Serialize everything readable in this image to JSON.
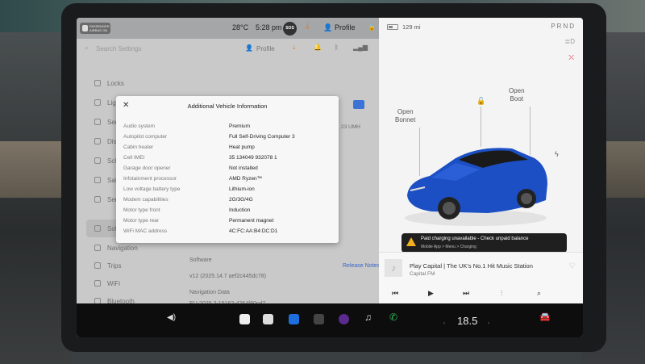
{
  "status_bar": {
    "airbag_label": "PASSENGER AIRBAG ON",
    "temperature": "28°C",
    "time": "5:28 pm",
    "sentry_label": "SOS",
    "profile": "Profile"
  },
  "settings": {
    "search_placeholder": "Search Settings",
    "profile": "Profile",
    "menu": [
      {
        "label": "Locks",
        "icon": "lock-icon"
      },
      {
        "label": "Lights",
        "icon": "lightbulb-icon"
      },
      {
        "label": "Service",
        "icon": "wrench-icon"
      },
      {
        "label": "Display",
        "icon": "display-icon"
      },
      {
        "label": "Schedule",
        "icon": "clock-icon"
      },
      {
        "label": "Safety",
        "icon": "shield-icon"
      },
      {
        "label": "Service",
        "icon": "wrench-icon"
      },
      {
        "label": "Software",
        "icon": "download-icon"
      },
      {
        "label": "Navigation",
        "icon": "navigation-icon"
      },
      {
        "label": "Trips",
        "icon": "trip-icon"
      },
      {
        "label": "WiFi",
        "icon": "wifi-icon"
      },
      {
        "label": "Bluetooth",
        "icon": "bluetooth-icon"
      }
    ],
    "vin_fragment": "23 UMH",
    "software_heading": "Software",
    "software_version": "v12 (2025.14.7 aef2c445dc78)",
    "release_notes": "Release Notes",
    "nav_data_heading": "Navigation Data",
    "nav_data_version": "EU-2025.2-15162-4264f80cd7"
  },
  "modal": {
    "title": "Additional Vehicle Information",
    "rows": [
      {
        "key": "Audio system",
        "value": "Premium"
      },
      {
        "key": "Autopilot computer",
        "value": "Full Self-Driving Computer 3"
      },
      {
        "key": "Cabin heater",
        "value": "Heat pump"
      },
      {
        "key": "Cell IMEI",
        "value": "35 134049 932078 1"
      },
      {
        "key": "Garage door opener",
        "value": "Not installed"
      },
      {
        "key": "Infotainment processor",
        "value": "AMD Ryzen™"
      },
      {
        "key": "Low voltage battery type",
        "value": "Lithium-ion"
      },
      {
        "key": "Modem capabilities",
        "value": "2G/3G/4G"
      },
      {
        "key": "Motor type front",
        "value": "Induction"
      },
      {
        "key": "Motor type rear",
        "value": "Permanent magnet"
      },
      {
        "key": "WiFi MAC address",
        "value": "4C:FC:AA:B4:DC:D1"
      }
    ]
  },
  "car_pane": {
    "range": "129 mi",
    "gear": "PRND",
    "open_bonnet": "Open\nBonnet",
    "open_boot": "Open\nBoot",
    "car_color": "#1c4fc4",
    "warning_title": "Paid charging unavailable - Check unpaid balance",
    "warning_sub": "Mobile App > Menu > Charging"
  },
  "music": {
    "title": "Play Capital | The UK's No.1 Hit Music Station",
    "source": "Capital FM"
  },
  "dock": {
    "climate_temp": "18.5"
  }
}
